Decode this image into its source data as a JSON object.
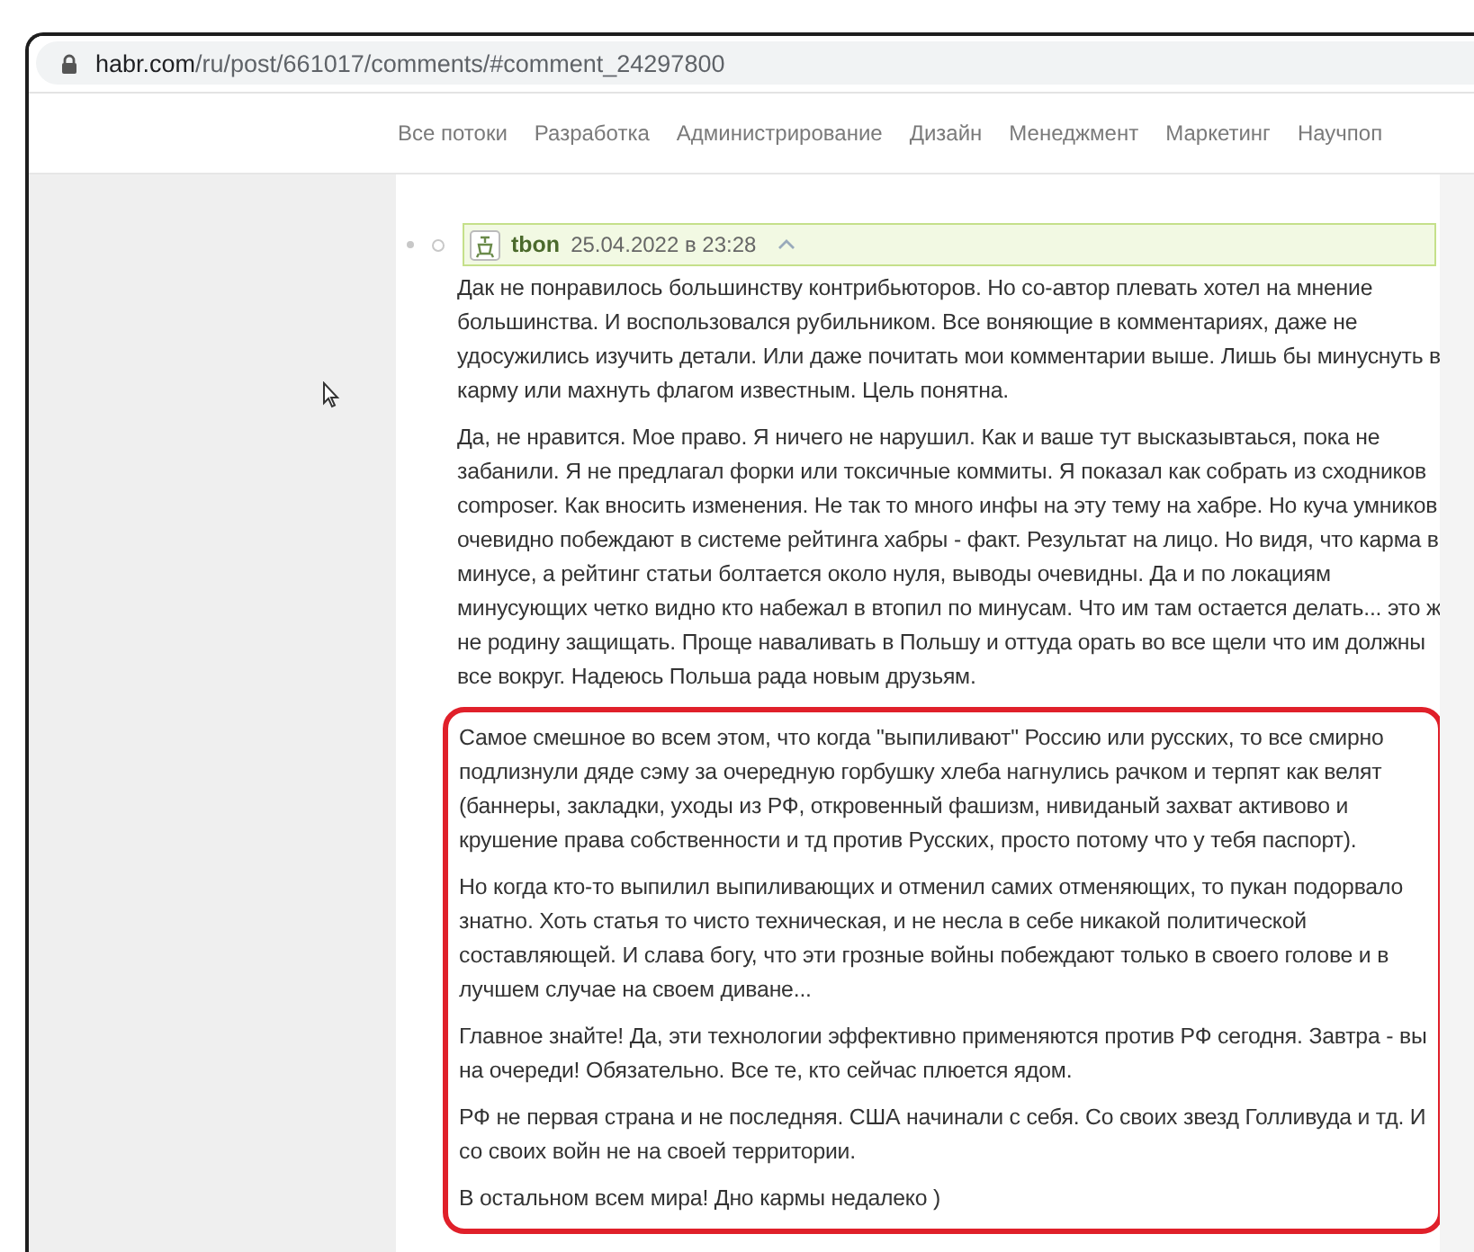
{
  "address_bar": {
    "host": "habr.com",
    "path": "/ru/post/661017/comments/#comment_24297800"
  },
  "nav": {
    "items": [
      {
        "label": "Все потоки"
      },
      {
        "label": "Разработка"
      },
      {
        "label": "Администрирование"
      },
      {
        "label": "Дизайн"
      },
      {
        "label": "Менеджмент"
      },
      {
        "label": "Маркетинг"
      },
      {
        "label": "Научпоп"
      }
    ]
  },
  "comment": {
    "author": "tbon",
    "date": "25.04.2022 в 23:28",
    "paragraphs": [
      {
        "text": "Дак не понравилось большинству контрибьюторов. Но со-автор плевать хотел на мнение большинства. И воспользовался рубильником. Все воняющие в комментариях, даже не удосужились изучить детали. Или даже почитать мои комментарии выше. Лишь бы минуснуть в карму или махнуть флагом известным. Цель понятна.",
        "highlighted": false
      },
      {
        "text": "Да, не нравится. Мое право. Я ничего не нарушил. Как и ваше тут высказывтаься, пока не забанили. Я не предлагал форки или токсичные коммиты. Я показал как собрать из сходников composer. Как вносить изменения. Не так то много инфы на эту тему на хабре. Но куча умников очевидно побеждают в системе рейтинга хабры - факт. Результат на лицо. Но видя, что карма в минусе, а рейтинг статьи болтается около нуля, выводы очевидны. Да и по локациям минусующих четко видно кто набежал в втопил по минусам. Что им там остается делать... это ж не родину защищать. Проще наваливать в Польшу и оттуда орать во все щели что им должны все вокруг. Надеюсь Польша рада новым друзьям.",
        "highlighted": false
      },
      {
        "text": "Самое смешное во всем этом, что когда \"выпиливают\" Россию или русских, то все смирно подлизнули дяде сэму за очередную горбушку хлеба нагнулись рачком и терпят как велят (баннеры, закладки, уходы из РФ, откровенный фашизм, нивиданый захват активово и крушение права собственности и тд против Русских, просто потому что у тебя паспорт).",
        "highlighted": true
      },
      {
        "text": "Но когда кто-то выпилил выпиливающих и отменил самих отменяющих, то пукан подорвало знатно. Хоть статья то чисто техническая, и не несла в себе никакой политической составляющей. И слава богу, что эти грозные войны побеждают только в своего голове и в лучшем случае на своем диване...",
        "highlighted": true
      },
      {
        "text": "Главное знайте! Да, эти технологии эффективно применяются против РФ сегодня. Завтра - вы на очереди! Обязательно. Все те, кто сейчас плюется ядом.",
        "highlighted": true
      },
      {
        "text": "РФ не первая страна и не последняя. США начинали с себя. Со своих звезд Голливуда и тд. И со своих войн не на своей территории.",
        "highlighted": true
      },
      {
        "text": "В остальном всем мира! Дно кармы недалеко )",
        "highlighted": true
      }
    ]
  }
}
